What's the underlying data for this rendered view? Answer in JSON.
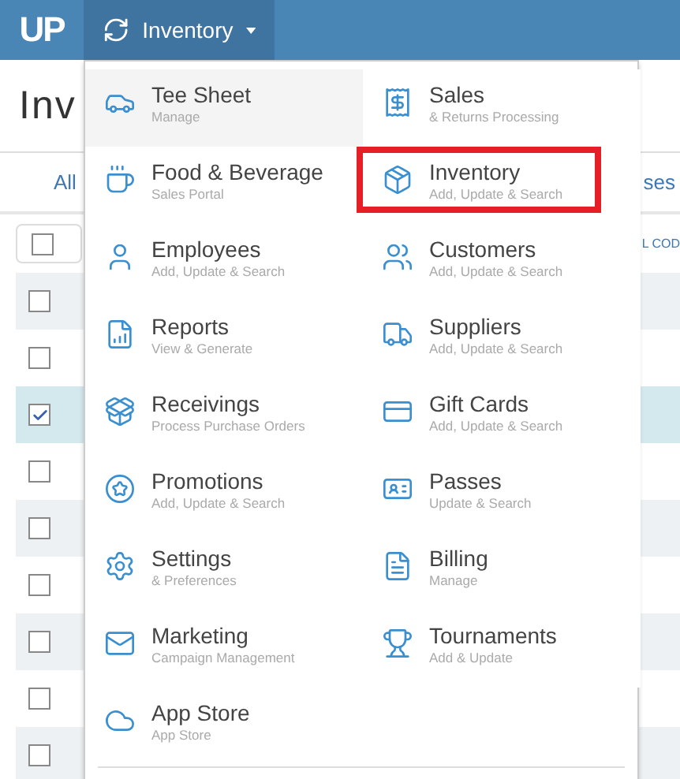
{
  "top_bar": {
    "logo": "UP",
    "nav_button": {
      "label": "Inventory",
      "expanded": true
    }
  },
  "page": {
    "title": "Inv",
    "tabs": [
      {
        "label": "All",
        "selected": false
      },
      {
        "label": "ses",
        "selected": false
      }
    ],
    "toolbar_text": "L COD",
    "rows": [
      {
        "checked": false
      },
      {
        "checked": false
      },
      {
        "checked": true
      },
      {
        "checked": false
      },
      {
        "checked": false
      },
      {
        "checked": false
      },
      {
        "checked": false
      },
      {
        "checked": false
      },
      {
        "checked": false
      }
    ]
  },
  "menu": {
    "items": [
      {
        "title": "Tee Sheet",
        "subtitle": "Manage",
        "hovered": true,
        "outlined": false
      },
      {
        "title": "Sales",
        "subtitle": "& Returns Processing",
        "hovered": false,
        "outlined": false
      },
      {
        "title": "Food & Beverage",
        "subtitle": "Sales Portal",
        "hovered": false,
        "outlined": false
      },
      {
        "title": "Inventory",
        "subtitle": "Add, Update & Search",
        "hovered": false,
        "outlined": true
      },
      {
        "title": "Employees",
        "subtitle": "Add, Update & Search",
        "hovered": false,
        "outlined": false
      },
      {
        "title": "Customers",
        "subtitle": "Add, Update & Search",
        "hovered": false,
        "outlined": false
      },
      {
        "title": "Reports",
        "subtitle": "View & Generate",
        "hovered": false,
        "outlined": false
      },
      {
        "title": "Suppliers",
        "subtitle": "Add, Update & Search",
        "hovered": false,
        "outlined": false
      },
      {
        "title": "Receivings",
        "subtitle": "Process Purchase Orders",
        "hovered": false,
        "outlined": false
      },
      {
        "title": "Gift Cards",
        "subtitle": "Add, Update & Search",
        "hovered": false,
        "outlined": false
      },
      {
        "title": "Promotions",
        "subtitle": "Add, Update & Search",
        "hovered": false,
        "outlined": false
      },
      {
        "title": "Passes",
        "subtitle": "Update & Search",
        "hovered": false,
        "outlined": false
      },
      {
        "title": "Settings",
        "subtitle": "& Preferences",
        "hovered": false,
        "outlined": false
      },
      {
        "title": "Billing",
        "subtitle": "Manage",
        "hovered": false,
        "outlined": false
      },
      {
        "title": "Marketing",
        "subtitle": "Campaign Management",
        "hovered": false,
        "outlined": false
      },
      {
        "title": "Tournaments",
        "subtitle": "Add & Update",
        "hovered": false,
        "outlined": false
      },
      {
        "title": "App Store",
        "subtitle": "App Store",
        "hovered": false,
        "outlined": false
      }
    ]
  }
}
